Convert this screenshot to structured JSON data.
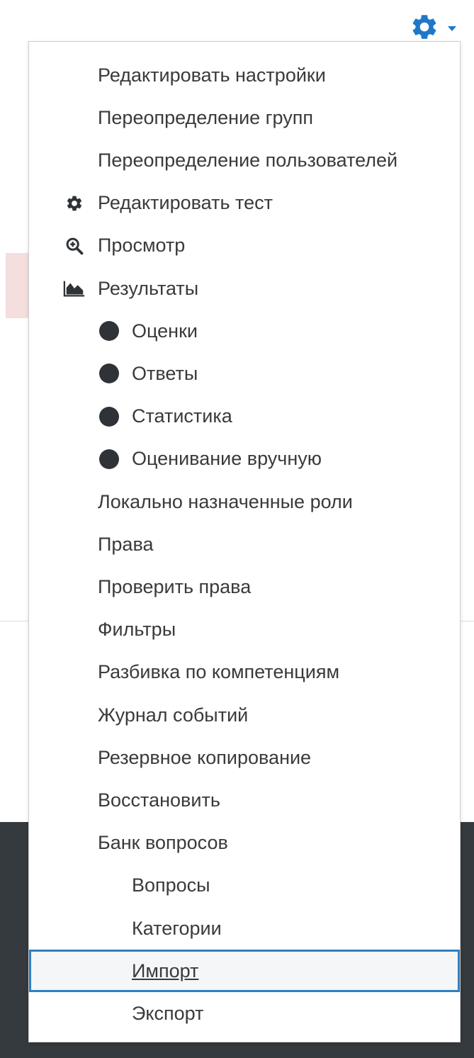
{
  "header": {
    "settings_icon": "gear-icon",
    "caret_icon": "caret-down-icon",
    "accent_color": "#1f77c9"
  },
  "menu": {
    "items": [
      {
        "label": "Редактировать настройки",
        "level": 0,
        "icon": null
      },
      {
        "label": "Переопределение групп",
        "level": 0,
        "icon": null
      },
      {
        "label": "Переопределение пользователей",
        "level": 0,
        "icon": null
      },
      {
        "label": "Редактировать тест",
        "level": 0,
        "icon": "gear-icon"
      },
      {
        "label": "Просмотр",
        "level": 0,
        "icon": "zoom-in-icon"
      },
      {
        "label": "Результаты",
        "level": 0,
        "icon": "area-chart-icon"
      },
      {
        "label": "Оценки",
        "level": 1,
        "icon": "bullet-icon"
      },
      {
        "label": "Ответы",
        "level": 1,
        "icon": "bullet-icon"
      },
      {
        "label": "Статистика",
        "level": 1,
        "icon": "bullet-icon"
      },
      {
        "label": "Оценивание вручную",
        "level": 1,
        "icon": "bullet-icon"
      },
      {
        "label": "Локально назначенные роли",
        "level": 0,
        "icon": null
      },
      {
        "label": "Права",
        "level": 0,
        "icon": null
      },
      {
        "label": "Проверить права",
        "level": 0,
        "icon": null
      },
      {
        "label": "Фильтры",
        "level": 0,
        "icon": null
      },
      {
        "label": "Разбивка по компетенциям",
        "level": 0,
        "icon": null
      },
      {
        "label": "Журнал событий",
        "level": 0,
        "icon": null
      },
      {
        "label": "Резервное копирование",
        "level": 0,
        "icon": null
      },
      {
        "label": "Восстановить",
        "level": 0,
        "icon": null
      },
      {
        "label": "Банк вопросов",
        "level": 0,
        "icon": null
      },
      {
        "label": "Вопросы",
        "level": 1,
        "icon": null
      },
      {
        "label": "Категории",
        "level": 1,
        "icon": null
      },
      {
        "label": "Импорт",
        "level": 1,
        "icon": null,
        "active": true
      },
      {
        "label": "Экспорт",
        "level": 1,
        "icon": null
      }
    ],
    "active_outline_color": "#2f7fc1",
    "text_color": "#3a3a3a",
    "bullet_color": "#2f3338"
  }
}
